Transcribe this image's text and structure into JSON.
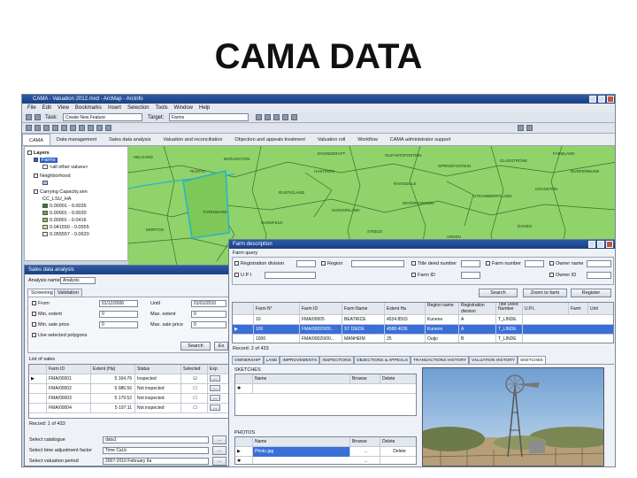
{
  "slide": {
    "title": "CAMA DATA"
  },
  "app": {
    "window_title": "CAMA - Valuation 2012.mxd - ArcMap - ArcInfo",
    "menu": [
      "File",
      "Edit",
      "View",
      "Bookmarks",
      "Insert",
      "Selection",
      "Tools",
      "Window",
      "Help"
    ],
    "editor": {
      "task_label": "Task:",
      "task_value": "Create New Feature",
      "target_label": "Target:",
      "target_value": "Farms"
    },
    "tabs": [
      "CAMA",
      "Data management",
      "Sales data analysis",
      "Valuation and reconciliation",
      "Objection and appeals treatment",
      "Valuation roll",
      "Workflow",
      "CAMA administrator support"
    ],
    "active_tab": "CAMA"
  },
  "toc": {
    "layers_label": "Layers",
    "items": [
      {
        "label": "Farms",
        "checked": true,
        "highlighted": true
      },
      {
        "label": "<all other values>",
        "checked": false
      },
      {
        "label": "Neighborhood",
        "checked": false
      },
      {
        "label": "Carrying Capacity.sen",
        "checked": true
      },
      {
        "label": "CC_LSU_HA",
        "checked": false
      }
    ],
    "legend": [
      {
        "label": "0.00001 - 0.0026",
        "color": "#2e7d32"
      },
      {
        "label": "0.00001 - 0.0020",
        "color": "#4caf50"
      },
      {
        "label": "0.00001 - 0.0416",
        "color": "#8bc34a"
      },
      {
        "label": "0.041550 - 0.0555",
        "color": "#c5e1a5"
      },
      {
        "label": "0.055557 - 0.0620",
        "color": "#e8f5e9"
      }
    ]
  },
  "map": {
    "labels": [
      "HELGARD",
      "BURLINGTON",
      "RUSTIG",
      "RUSTIGLAND",
      "DOUNDERAFT",
      "OLIFANTSFONTEIN",
      "SPRINGFONTEIN",
      "GLADSTRONE",
      "FARMLAND",
      "HASTINGS",
      "RAINSDALE",
      "TARENMARK",
      "GUNSFELD",
      "HUNVORLAND",
      "WATERFONTEIN",
      "STRAWBERRYLAND",
      "CRANSTON",
      "DUNFERMLINE",
      "MORTON",
      "PARKLAND",
      "STEELE",
      "ARDEN",
      "DAGEN",
      "BRIERLEY"
    ],
    "fill_color": "#8fd36a",
    "selected_parcel_color": "#2bb3c9"
  },
  "sales": {
    "title": "Sales data analysis",
    "analysis_name_label": "Analysis name",
    "analysis_name_value": "Analysis",
    "tabs": [
      "Screening",
      "Validation"
    ],
    "active_tab": "Screening",
    "from_label": "From",
    "from_value": "01/12/2006",
    "until_label": "Until",
    "until_value": "01/01/2010",
    "min_extent_label": "Min. extent",
    "min_extent_value": "0",
    "max_extent_label": "Max. extent",
    "max_extent_value": "0",
    "min_price_label": "Min. sale price",
    "min_price_value": "0",
    "max_price_label": "Max. sale price",
    "max_price_value": "0",
    "use_polygon_label": "Use selected polygons",
    "search_button": "Search",
    "close_button": "Ex",
    "list_label": "List of sales",
    "columns": [
      "Farm ID",
      "Extent (Ha)",
      "Status",
      "Selected",
      "Exp"
    ],
    "rows": [
      {
        "farm_id": "FMA/00001",
        "extent": "5 164.76",
        "status": "Inspected",
        "selected": true
      },
      {
        "farm_id": "FMA/00002",
        "extent": "5 086.56",
        "status": "Not inspected",
        "selected": false
      },
      {
        "farm_id": "FMA/00003",
        "extent": "5 179.52",
        "status": "Not inspected",
        "selected": false
      },
      {
        "farm_id": "FMA/00004",
        "extent": "5 197.11",
        "status": "Not inspected",
        "selected": false
      }
    ],
    "record_nav": "Record: 1 of 433",
    "catalogue_label": "Select catalogue",
    "catalogue_value": "data1",
    "adjust_label": "Select time adjustment factor",
    "adjust_value": "Time Cal.b",
    "refyear_label": "Select valuation period",
    "refyear_value": "2007-2010 February IIa"
  },
  "farm": {
    "title": "Farm description",
    "query_label": "Farm query",
    "query_fields": [
      "Registration division",
      "Region",
      "Title deed number",
      "Farm number",
      "Owner name",
      "U P I",
      "Farm ID",
      "Owner ID"
    ],
    "search_button": "Search",
    "zoom_button": "Zoom to farm",
    "register_button": "Register",
    "columns": [
      "Farm N°",
      "Farm ID",
      "Farm Name",
      "Extent Ha",
      "Region name",
      "Registration division",
      "Title Deed Number",
      "U.P.I.",
      "Farm",
      "Unit"
    ],
    "rows": [
      {
        "farm_no": "10",
        "farm_id": "FMA/00005",
        "name": "BEATRICE",
        "extent": "4534.8503",
        "region": "Kunene",
        "division": "A",
        "deed": "T_LINDE"
      },
      {
        "farm_no": "100",
        "farm_id": "FMA/00020/00...",
        "name": "ST DIEDE",
        "extent": "4588.4036",
        "region": "Kunene",
        "division": "A",
        "deed": "T_LINDE"
      },
      {
        "farm_no": "1000",
        "farm_id": "FMA/00020/00...",
        "name": "MANHEIM",
        "extent": "25",
        "region": "Outjo",
        "division": "B",
        "deed": "T_LINDE"
      }
    ],
    "record_nav": "Record: 2 of 433",
    "detail_tabs": [
      "OWNERSHIP",
      "LAND",
      "IMPROVEMENTS",
      "INSPECTIONS",
      "OBJECTIONS & APPEALS",
      "TRANSACTIONS HISTORY",
      "VALUATION HISTORY",
      "SKETCHES"
    ],
    "active_detail_tab": "SKETCHES",
    "sketches_label": "SKETCHES",
    "photos_label": "PHOTOS",
    "grid_columns": [
      "Name",
      "Browse",
      "Delete"
    ],
    "photo_row": {
      "name": "Photo.jpg",
      "browse": "...",
      "delete": "Delete"
    }
  }
}
